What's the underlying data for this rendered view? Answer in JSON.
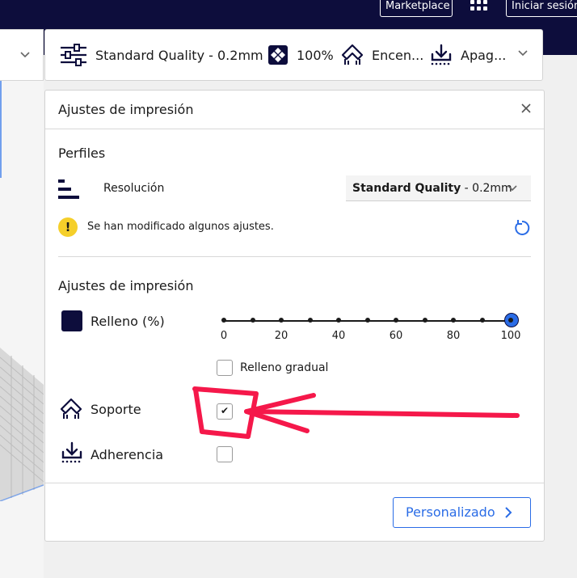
{
  "topbar": {
    "marketplace_label": "Marketplace",
    "signin_label": "Iniciar sesión"
  },
  "header": {
    "profile_label": "Standard Quality - 0.2mm",
    "infill_label": "100%",
    "support_label": "Encen...",
    "adhesion_label": "Apag..."
  },
  "panel": {
    "title": "Ajustes de impresión",
    "profiles_heading": "Perfiles",
    "resolution_label": "Resolución",
    "resolution_value_bold": "Standard Quality",
    "resolution_value_rest": " - 0.2mm",
    "warning_text": "Se han modificado algunos ajustes.",
    "settings_heading": "Ajustes de impresión",
    "infill_label": "Relleno (%)",
    "infill_value": 100,
    "slider_labels": [
      "0",
      "20",
      "40",
      "60",
      "80",
      "100"
    ],
    "gradual_label": "Relleno gradual",
    "gradual_checked": false,
    "support_label": "Soporte",
    "support_checked": true,
    "adhesion_label": "Adherencia",
    "adhesion_checked": false,
    "custom_button": "Personalizado"
  },
  "colors": {
    "dark_navy": "#0d0d3c",
    "accent_blue": "#2a6ce6",
    "warning_yellow": "#f5cf2a",
    "annotation_red": "#f5184a"
  },
  "icons": {
    "profile": "sliders-icon",
    "infill": "infill-pattern-icon",
    "support": "support-icon",
    "adhesion": "adhesion-icon",
    "reset": "reset-icon"
  }
}
